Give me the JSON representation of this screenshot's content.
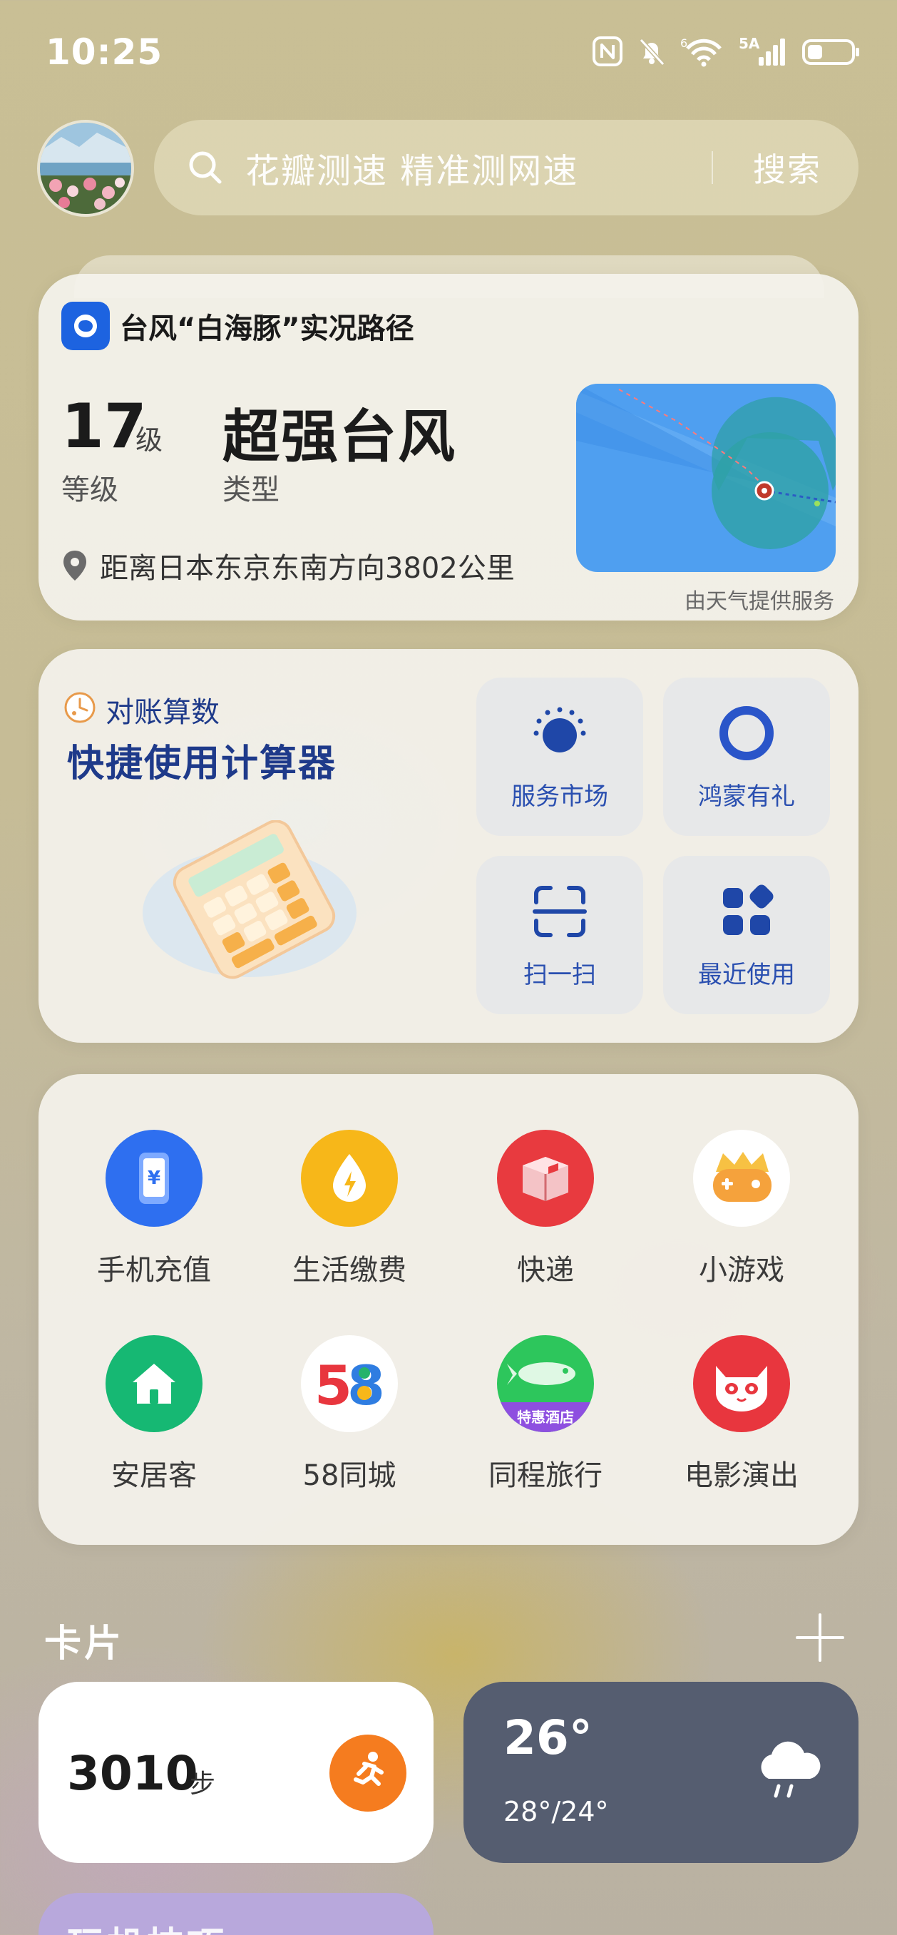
{
  "status_bar": {
    "time": "10:25",
    "signal_label": "5A"
  },
  "search": {
    "placeholder": "花瓣测速 精准测网速",
    "button": "搜索"
  },
  "typhoon": {
    "title": "台风“白海豚”实况路径",
    "level_value": "17",
    "level_unit": "级",
    "level_label": "等级",
    "type_value": "超强台风",
    "type_label": "类型",
    "distance": "距离日本东京东南方向3802公里",
    "source": "由天气提供服务"
  },
  "calculator": {
    "subtitle": "对账算数",
    "title": "快捷使用计算器",
    "tiles": [
      {
        "label": "服务市场",
        "icon": "service-market-icon"
      },
      {
        "label": "鸿蒙有礼",
        "icon": "harmony-gift-icon"
      },
      {
        "label": "扫一扫",
        "icon": "scan-icon"
      },
      {
        "label": "最近使用",
        "icon": "recent-apps-icon"
      }
    ]
  },
  "apps": [
    {
      "label": "手机充值",
      "icon": "phone-recharge-icon",
      "color": "#2e6ff0"
    },
    {
      "label": "生活缴费",
      "icon": "utility-payment-icon",
      "color": "#f7b719"
    },
    {
      "label": "快递",
      "icon": "express-box-icon",
      "color": "#e83a3f"
    },
    {
      "label": "小游戏",
      "icon": "mini-game-icon",
      "color": "#f5a23c"
    },
    {
      "label": "安居客",
      "icon": "anjuke-house-icon",
      "color": "#16b873"
    },
    {
      "label": "58同城",
      "icon": "58-logo-icon",
      "color": "#ffffff"
    },
    {
      "label": "同程旅行",
      "icon": "tongcheng-icon",
      "color": "#2dc65c"
    },
    {
      "label": "电影演出",
      "icon": "movie-cat-icon",
      "color": "#e8363e"
    }
  ],
  "tongcheng_badge": "特惠酒店",
  "cards_section": {
    "title": "卡片"
  },
  "steps": {
    "value": "3010",
    "unit": "步"
  },
  "weather": {
    "temp": "26°",
    "range": "28°/24°"
  },
  "peek_card": {
    "text": "玩机技巧"
  }
}
